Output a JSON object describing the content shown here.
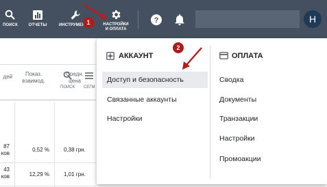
{
  "topbar": {
    "items": [
      {
        "label": "ПОИСК",
        "icon": "search-icon"
      },
      {
        "label": "ОТЧЕТЫ",
        "icon": "reports-chart-icon"
      },
      {
        "label": "ИНСТРУМЕНТЫ",
        "icon": "wrench-icon"
      },
      {
        "label": "НАСТРОЙКИ\nИ ОПЛАТА",
        "icon": "gear-icon"
      }
    ],
    "help_icon": "help-circle-icon",
    "bell_icon": "bell-icon",
    "avatar_letter": "H",
    "bar_color": "#44505f"
  },
  "background": {
    "tools": [
      {
        "label": "ПОИСК",
        "icon": "search-icon"
      },
      {
        "label": "СЕГМ",
        "icon": "segment-icon"
      }
    ],
    "columns": [
      {
        "label": "дей"
      },
      {
        "label": "Показ.\nвзаимод."
      },
      {
        "label": "Средн.\nцена"
      }
    ],
    "rows": [
      {
        "c0_top": "87",
        "c0_bottom": "ков",
        "c1": "0,52 %",
        "c2": "0,38 грн."
      },
      {
        "c0_top": "43",
        "c0_bottom": "ков",
        "c1": "12,29 %",
        "c2": "1,01 грн."
      }
    ]
  },
  "menu": {
    "account": {
      "heading": "АККАУНТ",
      "items": [
        "Доступ и безопасность",
        "Связанные аккаунты",
        "Настройки"
      ]
    },
    "billing": {
      "heading": "ОПЛАТА",
      "items": [
        "Сводка",
        "Документы",
        "Транзакции",
        "Настройки",
        "Промоакции"
      ]
    },
    "highlight_color": "#e8eaed"
  },
  "annotations": {
    "badge1": "1",
    "badge2": "2",
    "color": "#b01b1b"
  }
}
